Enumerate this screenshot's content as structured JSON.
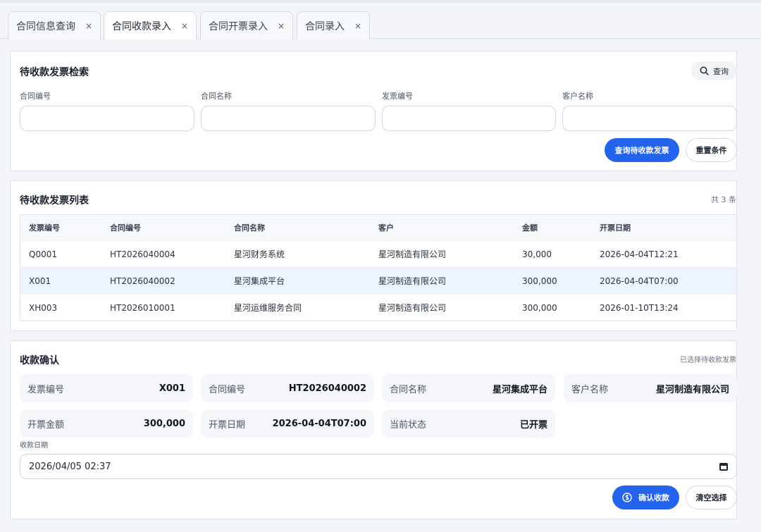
{
  "tabs": [
    {
      "label": "合同信息查询",
      "close": "×"
    },
    {
      "label": "合同收款录入",
      "close": "×"
    },
    {
      "label": "合同开票录入",
      "close": "×"
    },
    {
      "label": "合同录入",
      "close": "×"
    }
  ],
  "search": {
    "title": "待收款发票检索",
    "query_btn": "查询",
    "fields": [
      {
        "label": "合同编号",
        "value": "",
        "placeholder": ""
      },
      {
        "label": "合同名称",
        "value": "",
        "placeholder": ""
      },
      {
        "label": "发票编号",
        "value": "",
        "placeholder": ""
      },
      {
        "label": "客户名称",
        "value": "",
        "placeholder": ""
      }
    ],
    "submit_btn": "查询待收款发票",
    "reset_btn": "重置条件"
  },
  "list": {
    "title": "待收款发票列表",
    "count": "共 3 条",
    "columns": [
      "发票编号",
      "合同编号",
      "合同名称",
      "客户",
      "金额",
      "开票日期"
    ],
    "rows": [
      [
        "Q0001",
        "HT2026040004",
        "星河财务系统",
        "星河制造有限公司",
        "30,000",
        "2026-04-04T12:21"
      ],
      [
        "X001",
        "HT2026040002",
        "星河集成平台",
        "星河制造有限公司",
        "300,000",
        "2026-04-04T07:00"
      ],
      [
        "XH003",
        "HT2026010001",
        "星河运维服务合同",
        "星河制造有限公司",
        "300,000",
        "2026-01-10T13:24"
      ]
    ],
    "selected_row": 1
  },
  "confirm": {
    "title": "收款确认",
    "status_note": "已选择待收款发票",
    "cards": [
      {
        "key": "发票编号",
        "value": "X001"
      },
      {
        "key": "合同编号",
        "value": "HT2026040002"
      },
      {
        "key": "合同名称",
        "value": "星河集成平台"
      },
      {
        "key": "客户名称",
        "value": "星河制造有限公司"
      },
      {
        "key": "开票金额",
        "value": "300,000"
      },
      {
        "key": "开票日期",
        "value": "2026-04-04T07:00"
      },
      {
        "key": "当前状态",
        "value": "已开票"
      }
    ],
    "date_label": "收款日期",
    "date_value": "2026/04/05 02:37",
    "confirm_btn": "确认收款",
    "clear_btn": "清空选择"
  },
  "colors": {
    "accent": "#2463eb",
    "selected_row": "#edf3ff"
  }
}
